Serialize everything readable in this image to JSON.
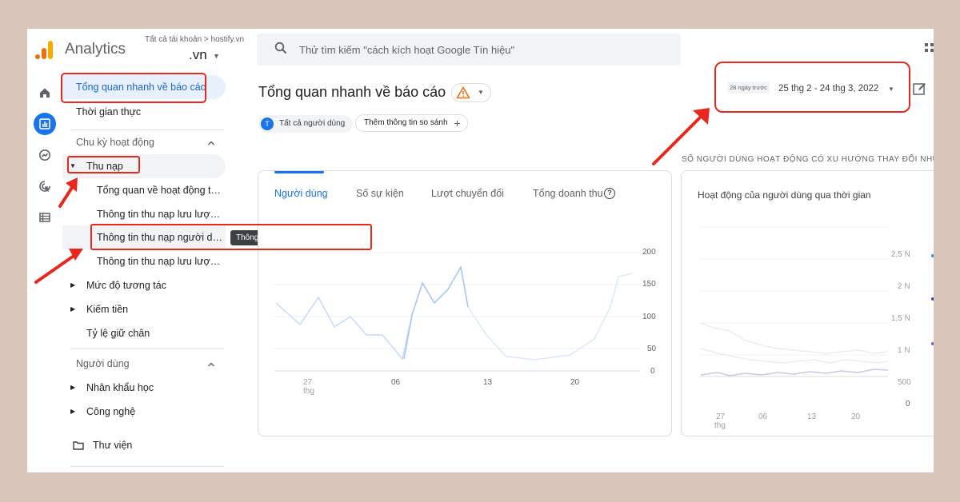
{
  "header": {
    "app_title": "Analytics",
    "account_path": "Tất cả tài khoản > hostify.vn",
    "property": ".vn",
    "search_placeholder": "Thử tìm kiếm \"cách kích hoạt Google Tín hiệu\""
  },
  "nav": {
    "overview": "Tổng quan nhanh về báo cáo",
    "realtime": "Thời gian thực",
    "lifecycle": {
      "title": "Chu kỳ hoạt động",
      "acquisition": "Thu nạp",
      "acquisition_children": [
        "Tổng quan về hoạt động th...",
        "Thông tin thu nạp lưu lượn...",
        "Thông tin thu nạp người dù...",
        "Thông tin thu nạp lưu lượn..."
      ],
      "engagement": "Mức độ tương tác",
      "monetization": "Kiếm tiền",
      "retention": "Tỷ lệ giữ chân"
    },
    "user": {
      "title": "Người dùng",
      "demographics": "Nhân khẩu học",
      "tech": "Công nghệ"
    },
    "library": "Thư viện"
  },
  "tooltip": "Thông tin thu nạp người dùng",
  "main": {
    "title": "Tổng quan nhanh về báo cáo",
    "chip_all_users": "Tất cả người dùng",
    "chip_avatar": "T",
    "chip_compare": "Thêm thông tin so sánh",
    "date_chip": "28 ngày trước",
    "date_range": "25 thg 2 - 24 thg 3, 2022",
    "trend_heading": "SỐ NGƯỜI DÙNG HOẠT ĐỘNG CÓ XU HƯỚNG THAY ĐỔI NHƯ TH"
  },
  "card1": {
    "tabs": [
      "Người dùng",
      "Số sự kiện",
      "Lượt chuyển đổi",
      "Tổng doanh thu"
    ],
    "help": "?",
    "yticks": [
      "200",
      "150",
      "100",
      "50",
      "0"
    ],
    "xticks": [
      "27",
      "thg",
      "06",
      "13",
      "20"
    ]
  },
  "card2": {
    "title": "Hoạt động của người dùng qua thời gian",
    "yticks": [
      "2,5 N",
      "2 N",
      "1,5 N",
      "1 N",
      "500",
      "0"
    ],
    "xticks": [
      "27",
      "thg",
      "06",
      "13",
      "20"
    ]
  },
  "colors": {
    "accent": "#1a73e8",
    "annotation": "#e8281e",
    "warning": "#e8710a"
  }
}
